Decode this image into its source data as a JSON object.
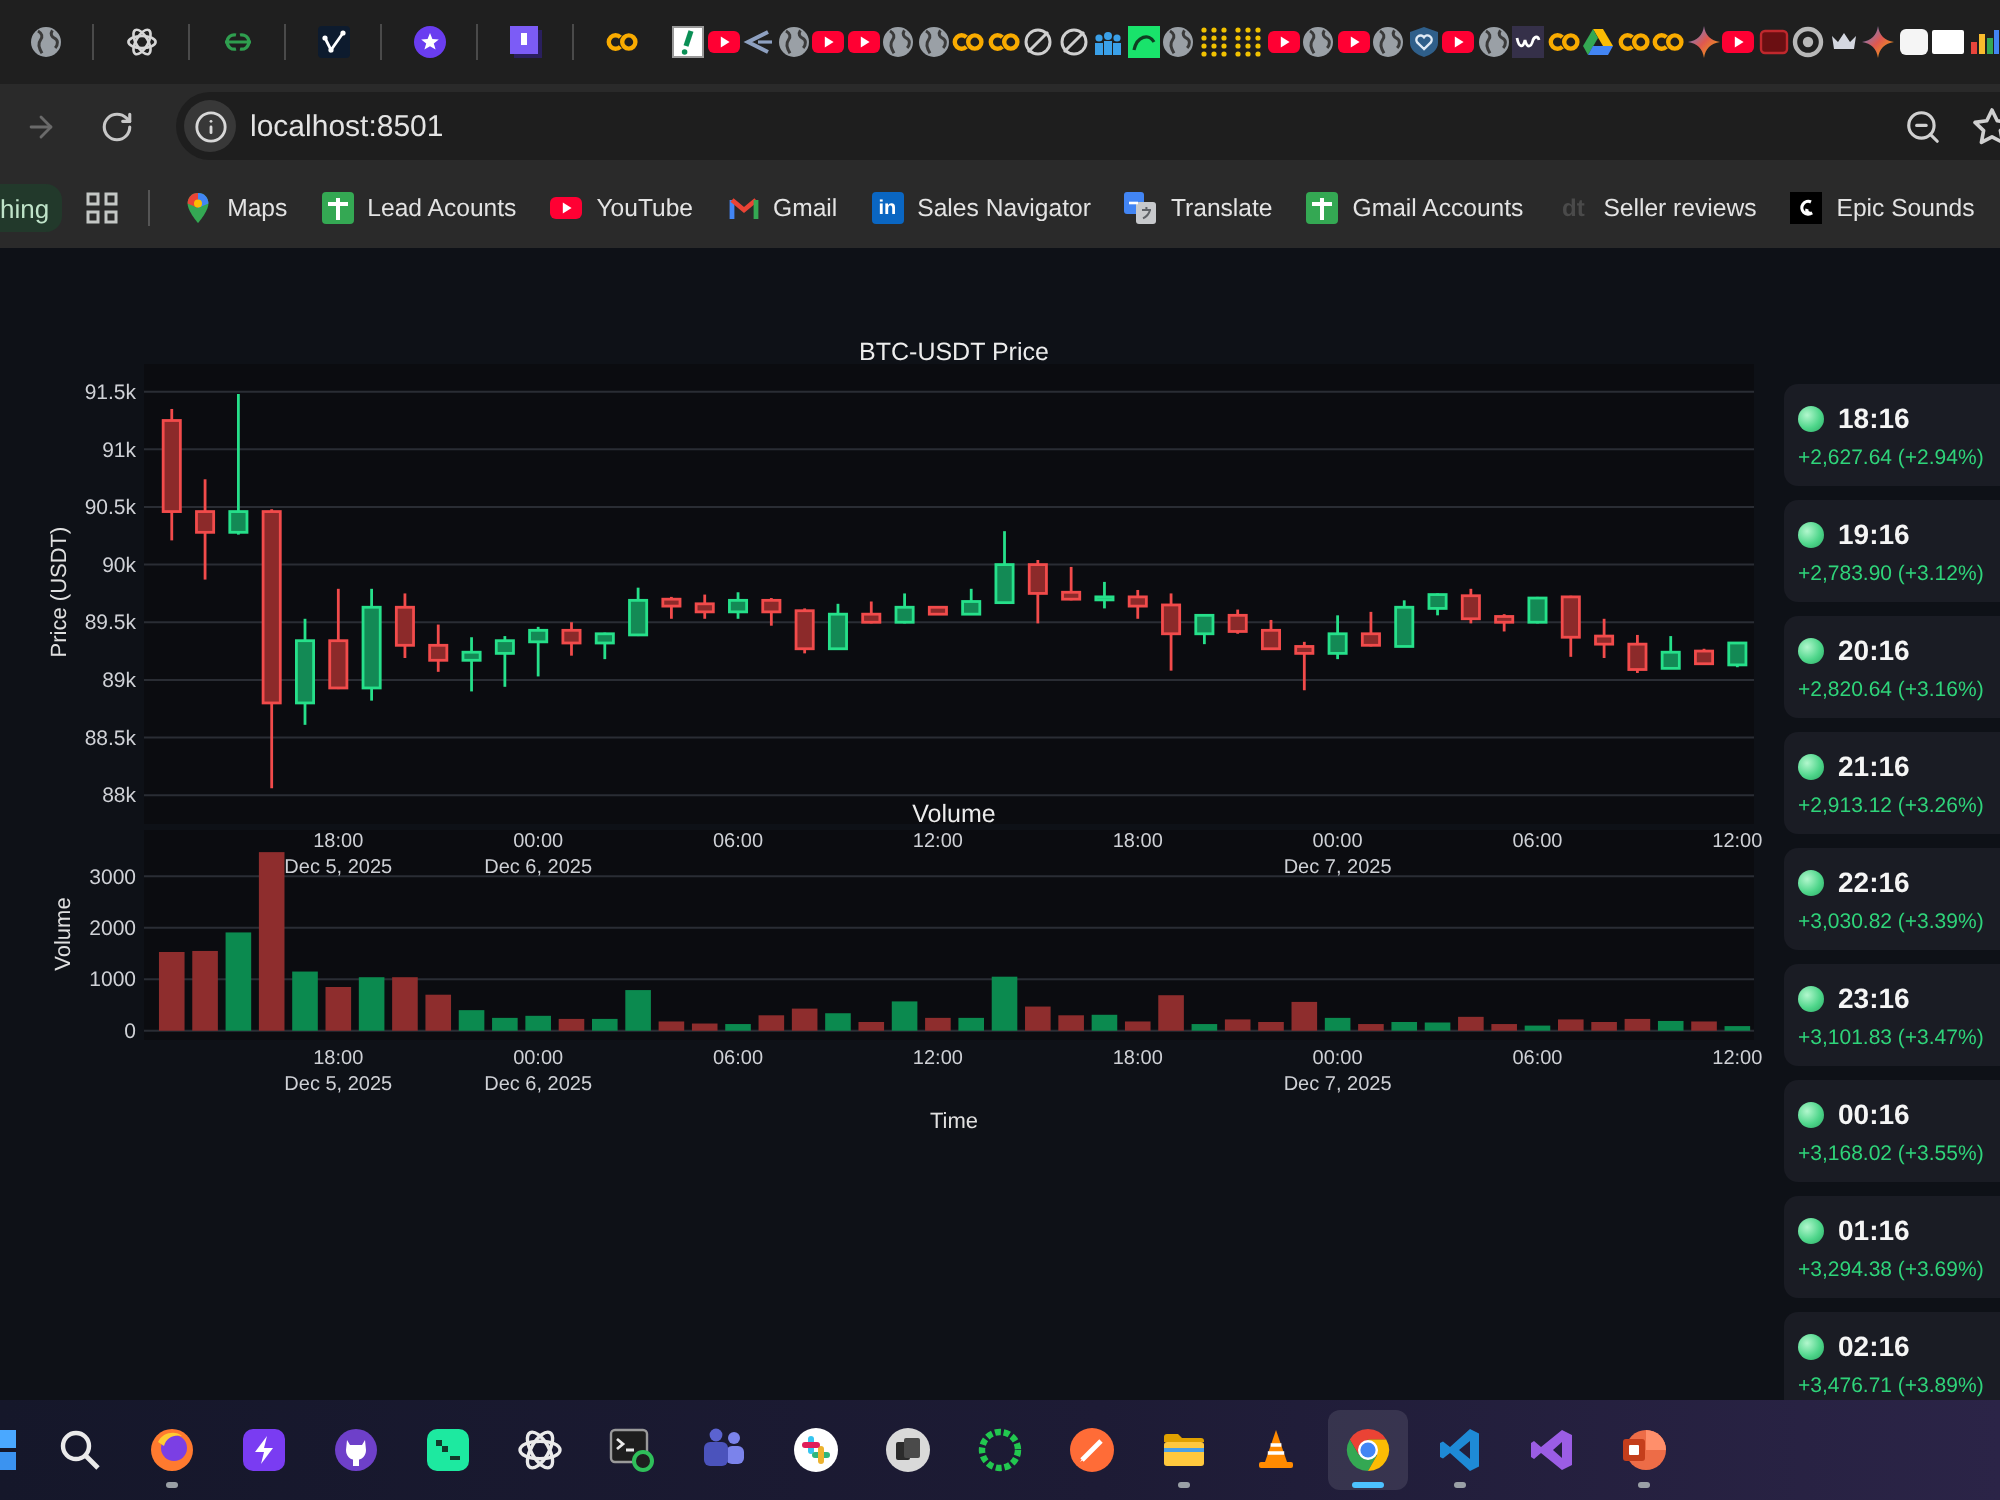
{
  "browser": {
    "forward_button": {
      "disabled": true
    },
    "address": "localhost:8501"
  },
  "bookmarks_bar": {
    "group_chip": "hing",
    "bookmarks": [
      {
        "kind": "pin",
        "label": "Maps"
      },
      {
        "kind": "sheet",
        "label": "Lead Acounts"
      },
      {
        "kind": "play",
        "label": "YouTube"
      },
      {
        "kind": "mail",
        "label": "Gmail"
      },
      {
        "kind": "tile",
        "icon_text": "in",
        "label": "Sales Navigator"
      },
      {
        "kind": "translate",
        "label": "Translate"
      },
      {
        "kind": "sheet",
        "label": "Gmail Accounts"
      },
      {
        "kind": "text",
        "icon_text": "dt",
        "label": "Seller reviews"
      },
      {
        "kind": "swirl",
        "label": "Epic Sounds"
      }
    ]
  },
  "price_chart": {
    "chart_data": {
      "type": "candlestick",
      "title": "BTC-USDT Price",
      "ylabel": "Price (USDT)",
      "x": [
        "2025-12-05 13:00",
        "2025-12-05 14:00",
        "2025-12-05 15:00",
        "2025-12-05 16:00",
        "2025-12-05 17:00",
        "2025-12-05 18:00",
        "2025-12-05 19:00",
        "2025-12-05 20:00",
        "2025-12-05 21:00",
        "2025-12-05 22:00",
        "2025-12-05 23:00",
        "2025-12-06 00:00",
        "2025-12-06 01:00",
        "2025-12-06 02:00",
        "2025-12-06 03:00",
        "2025-12-06 04:00",
        "2025-12-06 05:00",
        "2025-12-06 06:00",
        "2025-12-06 07:00",
        "2025-12-06 08:00",
        "2025-12-06 09:00",
        "2025-12-06 10:00",
        "2025-12-06 11:00",
        "2025-12-06 12:00",
        "2025-12-06 13:00",
        "2025-12-06 14:00",
        "2025-12-06 15:00",
        "2025-12-06 16:00",
        "2025-12-06 17:00",
        "2025-12-06 18:00",
        "2025-12-06 19:00",
        "2025-12-06 20:00",
        "2025-12-06 21:00",
        "2025-12-06 22:00",
        "2025-12-06 23:00",
        "2025-12-07 00:00",
        "2025-12-07 01:00",
        "2025-12-07 02:00",
        "2025-12-07 03:00",
        "2025-12-07 04:00",
        "2025-12-07 05:00",
        "2025-12-07 06:00",
        "2025-12-07 07:00",
        "2025-12-07 08:00",
        "2025-12-07 09:00",
        "2025-12-07 10:00",
        "2025-12-07 11:00",
        "2025-12-07 12:00"
      ],
      "ohlc": [
        [
          91250,
          91350,
          90210,
          90460
        ],
        [
          90460,
          90740,
          89870,
          90280
        ],
        [
          90280,
          91480,
          90260,
          90460
        ],
        [
          90460,
          90480,
          88060,
          88800
        ],
        [
          88800,
          89530,
          88610,
          89340
        ],
        [
          89340,
          89790,
          88920,
          88930
        ],
        [
          88930,
          89790,
          88820,
          89630
        ],
        [
          89630,
          89750,
          89190,
          89300
        ],
        [
          89300,
          89480,
          89070,
          89170
        ],
        [
          89170,
          89370,
          88900,
          89240
        ],
        [
          89230,
          89380,
          88940,
          89340
        ],
        [
          89330,
          89460,
          89030,
          89430
        ],
        [
          89430,
          89500,
          89210,
          89320
        ],
        [
          89320,
          89410,
          89180,
          89400
        ],
        [
          89390,
          89800,
          89380,
          89690
        ],
        [
          89700,
          89720,
          89530,
          89640
        ],
        [
          89660,
          89740,
          89530,
          89590
        ],
        [
          89590,
          89760,
          89530,
          89690
        ],
        [
          89690,
          89710,
          89470,
          89590
        ],
        [
          89600,
          89620,
          89230,
          89270
        ],
        [
          89270,
          89660,
          89270,
          89570
        ],
        [
          89570,
          89680,
          89490,
          89500
        ],
        [
          89500,
          89750,
          89490,
          89630
        ],
        [
          89630,
          89640,
          89570,
          89570
        ],
        [
          89570,
          89790,
          89570,
          89680
        ],
        [
          89670,
          90290,
          89660,
          90000
        ],
        [
          90000,
          90040,
          89490,
          89750
        ],
        [
          89760,
          89980,
          89690,
          89700
        ],
        [
          89700,
          89850,
          89620,
          89720
        ],
        [
          89720,
          89780,
          89530,
          89640
        ],
        [
          89650,
          89750,
          89080,
          89400
        ],
        [
          89400,
          89560,
          89310,
          89560
        ],
        [
          89560,
          89610,
          89400,
          89420
        ],
        [
          89430,
          89520,
          89260,
          89270
        ],
        [
          89290,
          89330,
          88910,
          89230
        ],
        [
          89230,
          89560,
          89180,
          89400
        ],
        [
          89400,
          89590,
          89290,
          89300
        ],
        [
          89290,
          89690,
          89290,
          89630
        ],
        [
          89620,
          89750,
          89560,
          89740
        ],
        [
          89730,
          89790,
          89490,
          89530
        ],
        [
          89550,
          89570,
          89420,
          89500
        ],
        [
          89500,
          89720,
          89490,
          89710
        ],
        [
          89720,
          89730,
          89200,
          89370
        ],
        [
          89380,
          89530,
          89190,
          89310
        ],
        [
          89310,
          89390,
          89060,
          89090
        ],
        [
          89100,
          89380,
          89100,
          89240
        ],
        [
          89250,
          89270,
          89140,
          89140
        ],
        [
          89130,
          89320,
          89110,
          89320
        ]
      ],
      "xlim": [
        "2025-12-05 12:10",
        "2025-12-07 12:30"
      ],
      "ylim": [
        87750,
        91740
      ],
      "grid": true,
      "yticks": [
        {
          "value": 91500,
          "label": "91.5k"
        },
        {
          "value": 91000,
          "label": "91k"
        },
        {
          "value": 90500,
          "label": "90.5k"
        },
        {
          "value": 90000,
          "label": "90k"
        },
        {
          "value": 89500,
          "label": "89.5k"
        },
        {
          "value": 89000,
          "label": "89k"
        },
        {
          "value": 88500,
          "label": "88.5k"
        },
        {
          "value": 88000,
          "label": "88k"
        }
      ],
      "xticks": [
        {
          "value": "2025-12-05 18:00",
          "label": "18:00\nDec 5, 2025"
        },
        {
          "value": "2025-12-06 00:00",
          "label": "00:00\nDec 6, 2025"
        },
        {
          "value": "2025-12-06 06:00",
          "label": "06:00"
        },
        {
          "value": "2025-12-06 12:00",
          "label": "12:00"
        },
        {
          "value": "2025-12-06 18:00",
          "label": "18:00"
        },
        {
          "value": "2025-12-07 00:00",
          "label": "00:00\nDec 7, 2025"
        },
        {
          "value": "2025-12-07 06:00",
          "label": "06:00"
        },
        {
          "value": "2025-12-07 12:00",
          "label": "12:00"
        }
      ]
    }
  },
  "volume_chart": {
    "chart_data": {
      "type": "bar",
      "title": "Volume",
      "xlabel": "Time",
      "ylabel": "Volume",
      "x": [
        "2025-12-05 13:00",
        "2025-12-05 14:00",
        "2025-12-05 15:00",
        "2025-12-05 16:00",
        "2025-12-05 17:00",
        "2025-12-05 18:00",
        "2025-12-05 19:00",
        "2025-12-05 20:00",
        "2025-12-05 21:00",
        "2025-12-05 22:00",
        "2025-12-05 23:00",
        "2025-12-06 00:00",
        "2025-12-06 01:00",
        "2025-12-06 02:00",
        "2025-12-06 03:00",
        "2025-12-06 04:00",
        "2025-12-06 05:00",
        "2025-12-06 06:00",
        "2025-12-06 07:00",
        "2025-12-06 08:00",
        "2025-12-06 09:00",
        "2025-12-06 10:00",
        "2025-12-06 11:00",
        "2025-12-06 12:00",
        "2025-12-06 13:00",
        "2025-12-06 14:00",
        "2025-12-06 15:00",
        "2025-12-06 16:00",
        "2025-12-06 17:00",
        "2025-12-06 18:00",
        "2025-12-06 19:00",
        "2025-12-06 20:00",
        "2025-12-06 21:00",
        "2025-12-06 22:00",
        "2025-12-06 23:00",
        "2025-12-07 00:00",
        "2025-12-07 01:00",
        "2025-12-07 02:00",
        "2025-12-07 03:00",
        "2025-12-07 04:00",
        "2025-12-07 05:00",
        "2025-12-07 06:00",
        "2025-12-07 07:00",
        "2025-12-07 08:00",
        "2025-12-07 09:00",
        "2025-12-07 10:00",
        "2025-12-07 11:00",
        "2025-12-07 12:00"
      ],
      "values": [
        1530,
        1550,
        1910,
        3470,
        1150,
        850,
        1040,
        1040,
        700,
        400,
        250,
        290,
        230,
        230,
        790,
        180,
        140,
        130,
        300,
        430,
        340,
        170,
        570,
        250,
        250,
        1050,
        470,
        300,
        310,
        180,
        690,
        130,
        220,
        170,
        560,
        250,
        130,
        170,
        160,
        270,
        130,
        100,
        220,
        170,
        230,
        190,
        180,
        90
      ],
      "xlim": [
        "2025-12-05 12:10",
        "2025-12-07 12:30"
      ],
      "ylim": [
        -180,
        3900
      ],
      "grid": true,
      "yticks": [
        0,
        1000,
        2000,
        3000
      ],
      "xticks": [
        {
          "value": "2025-12-05 18:00",
          "label": "18:00\nDec 5, 2025"
        },
        {
          "value": "2025-12-06 00:00",
          "label": "00:00\nDec 6, 2025"
        },
        {
          "value": "2025-12-06 06:00",
          "label": "06:00"
        },
        {
          "value": "2025-12-06 12:00",
          "label": "12:00"
        },
        {
          "value": "2025-12-06 18:00",
          "label": "18:00"
        },
        {
          "value": "2025-12-07 00:00",
          "label": "00:00\nDec 7, 2025"
        },
        {
          "value": "2025-12-07 06:00",
          "label": "06:00"
        },
        {
          "value": "2025-12-07 12:00",
          "label": "12:00"
        }
      ]
    }
  },
  "price_changes": [
    {
      "time": "18:16",
      "change": "+2,627.64 (+2.94%)"
    },
    {
      "time": "19:16",
      "change": "+2,783.90 (+3.12%)"
    },
    {
      "time": "20:16",
      "change": "+2,820.64 (+3.16%)"
    },
    {
      "time": "21:16",
      "change": "+2,913.12 (+3.26%)"
    },
    {
      "time": "22:16",
      "change": "+3,030.82 (+3.39%)"
    },
    {
      "time": "23:16",
      "change": "+3,101.83 (+3.47%)"
    },
    {
      "time": "00:16",
      "change": "+3,168.02 (+3.55%)"
    },
    {
      "time": "01:16",
      "change": "+3,294.38 (+3.69%)"
    },
    {
      "time": "02:16",
      "change": "+3,476.71 (+3.89%)"
    }
  ],
  "taskbar": {
    "apps": [
      {
        "kind": "grid",
        "running": false,
        "selected": false
      },
      {
        "kind": "search",
        "running": false,
        "selected": false
      },
      {
        "kind": "orb",
        "running": true,
        "selected": false
      },
      {
        "kind": "bolt",
        "running": false,
        "selected": false
      },
      {
        "kind": "cat",
        "running": false,
        "selected": false
      },
      {
        "kind": "gamepad",
        "running": false,
        "selected": false
      },
      {
        "kind": "knot",
        "running": false,
        "selected": false
      },
      {
        "kind": "terminal",
        "running": false,
        "selected": false
      },
      {
        "kind": "people",
        "running": false,
        "selected": false
      },
      {
        "kind": "hash",
        "running": false,
        "selected": false
      },
      {
        "kind": "cards",
        "running": false,
        "selected": false
      },
      {
        "kind": "ring",
        "running": false,
        "selected": false
      },
      {
        "kind": "pen",
        "running": false,
        "selected": false
      },
      {
        "kind": "folder",
        "running": true,
        "selected": false
      },
      {
        "kind": "cone",
        "running": false,
        "selected": false
      },
      {
        "kind": "aperture",
        "running": true,
        "selected": true
      },
      {
        "kind": "ribbon",
        "running": true,
        "selected": false
      },
      {
        "kind": "infinity",
        "running": false,
        "selected": false
      },
      {
        "kind": "slides",
        "running": true,
        "selected": false
      }
    ]
  }
}
